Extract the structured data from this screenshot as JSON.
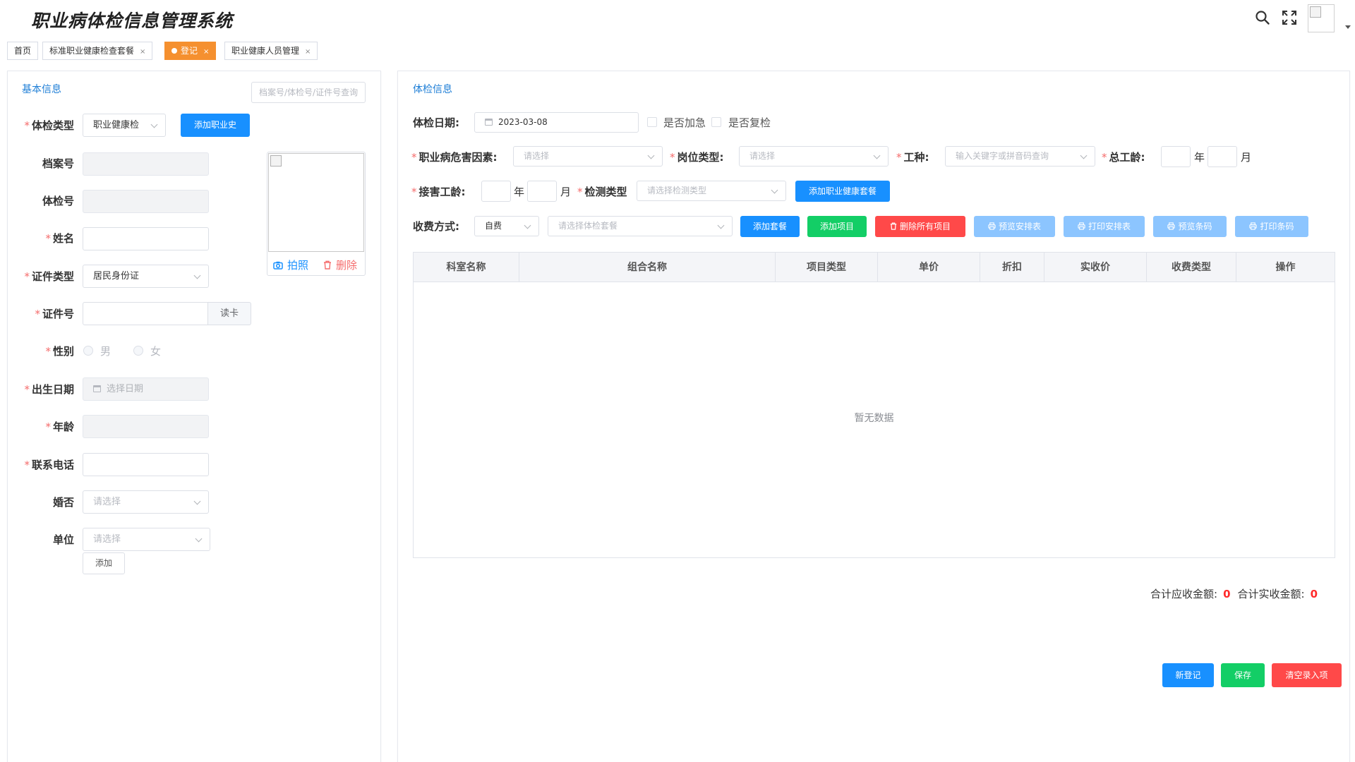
{
  "app": {
    "title": "职业病体检信息管理系统"
  },
  "tabs": [
    {
      "label": "首页",
      "closable": false,
      "active": false
    },
    {
      "label": "标准职业健康检查套餐",
      "closable": true,
      "active": false
    },
    {
      "label": "登记",
      "closable": true,
      "active": true
    },
    {
      "label": "职业健康人员管理",
      "closable": true,
      "active": false
    }
  ],
  "close_glyph": "×",
  "basic": {
    "title": "基本信息",
    "search_placeholder": "档案号/体检号/证件号查询",
    "exam_type": {
      "label": "体检类型",
      "value": "职业健康检"
    },
    "add_history_btn": "添加职业史",
    "file_no": {
      "label": "档案号",
      "value": ""
    },
    "exam_no": {
      "label": "体检号",
      "value": ""
    },
    "name": {
      "label": "姓名",
      "value": ""
    },
    "id_type": {
      "label": "证件类型",
      "value": "居民身份证"
    },
    "id_no": {
      "label": "证件号",
      "value": ""
    },
    "read_card_btn": "读卡",
    "gender": {
      "label": "性别",
      "options": [
        "男",
        "女"
      ]
    },
    "birth": {
      "label": "出生日期",
      "placeholder": "选择日期"
    },
    "age": {
      "label": "年龄",
      "value": ""
    },
    "phone": {
      "label": "联系电话",
      "value": ""
    },
    "married": {
      "label": "婚否",
      "placeholder": "请选择"
    },
    "unit": {
      "label": "单位",
      "placeholder": "请选择"
    },
    "add_unit_btn": "添加",
    "photo": {
      "take": "拍照",
      "delete": "删除"
    }
  },
  "exam": {
    "title": "体检信息",
    "date": {
      "label": "体检日期:",
      "value": "2023-03-08"
    },
    "urgent": "是否加急",
    "recheck": "是否复检",
    "hazard": {
      "label": "职业病危害因素:",
      "placeholder": "请选择"
    },
    "post_type": {
      "label": "岗位类型:",
      "placeholder": "请选择"
    },
    "work_kind": {
      "label": "工种:",
      "placeholder": "输入关键字或拼音码查询"
    },
    "total_years": {
      "label": "总工龄:",
      "year_unit": "年",
      "month_unit": "月"
    },
    "exposure_years": {
      "label": "接害工龄:",
      "year_unit": "年",
      "month_unit": "月"
    },
    "detect_type": {
      "label": "检测类型",
      "placeholder": "请选择检测类型"
    },
    "add_package_btn": "添加职业健康套餐",
    "pay": {
      "label": "收费方式:",
      "value": "自费"
    },
    "package_placeholder": "请选择体检套餐",
    "buttons": {
      "add_set": "添加套餐",
      "add_item": "添加项目",
      "delete_all": "删除所有项目",
      "preview_schedule": "预览安排表",
      "print_schedule": "打印安排表",
      "preview_barcode": "预览条码",
      "print_barcode": "打印条码"
    },
    "table": {
      "columns": [
        "科室名称",
        "组合名称",
        "项目类型",
        "单价",
        "折扣",
        "实收价",
        "收费类型",
        "操作"
      ],
      "rows": [],
      "empty_text": "暂无数据"
    },
    "totals": {
      "due_label": "合计应收金额:",
      "due_value": "0",
      "actual_label": "合计实收金额:",
      "actual_value": "0"
    },
    "actions": {
      "new": "新登记",
      "save": "保存",
      "clear": "清空录入项"
    }
  },
  "colors": {
    "accent": "#1890ff",
    "tab_active": "#f5902f",
    "success": "#13ce66",
    "danger": "#ff4949",
    "required": "#f56c6c"
  }
}
